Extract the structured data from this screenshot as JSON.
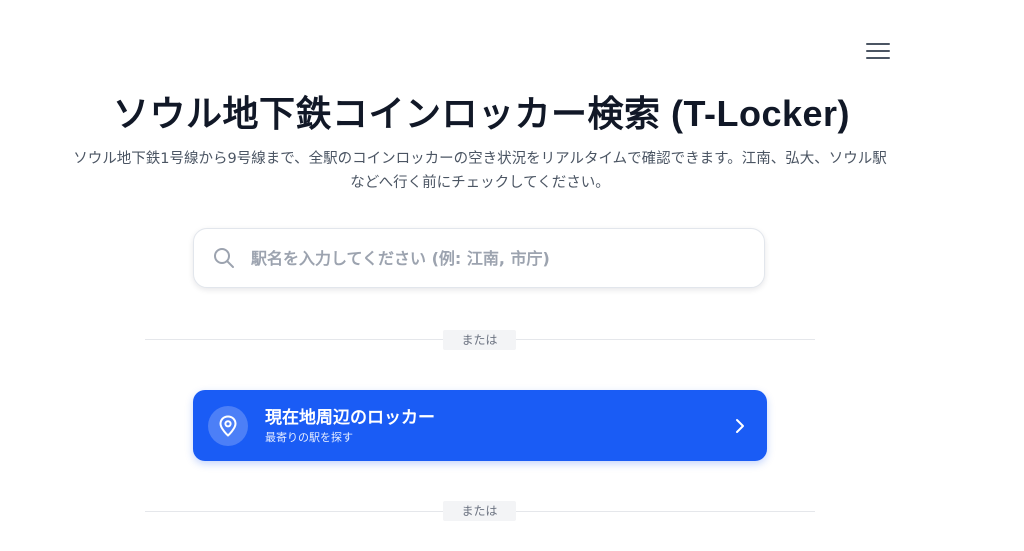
{
  "header": {
    "menu_icon": "hamburger-icon"
  },
  "hero": {
    "title": "ソウル地下鉄コインロッカー検索 (T-Locker)",
    "subtitle": "ソウル地下鉄1号線から9号線まで、全駅のコインロッカーの空き状況をリアルタイムで確認できます。江南、弘大、ソウル駅などへ行く前にチェックしてください。"
  },
  "search": {
    "icon": "search-icon",
    "placeholder": "駅名を入力してください (例: 江南, 市庁)",
    "value": ""
  },
  "dividers": {
    "first_label": "または",
    "second_label": "または"
  },
  "nearby": {
    "icon": "location-pin-icon",
    "title": "現在地周辺のロッカー",
    "subtitle": "最寄りの駅を探す",
    "chevron": "chevron-right-icon",
    "accent_color": "#1a5cf5"
  }
}
